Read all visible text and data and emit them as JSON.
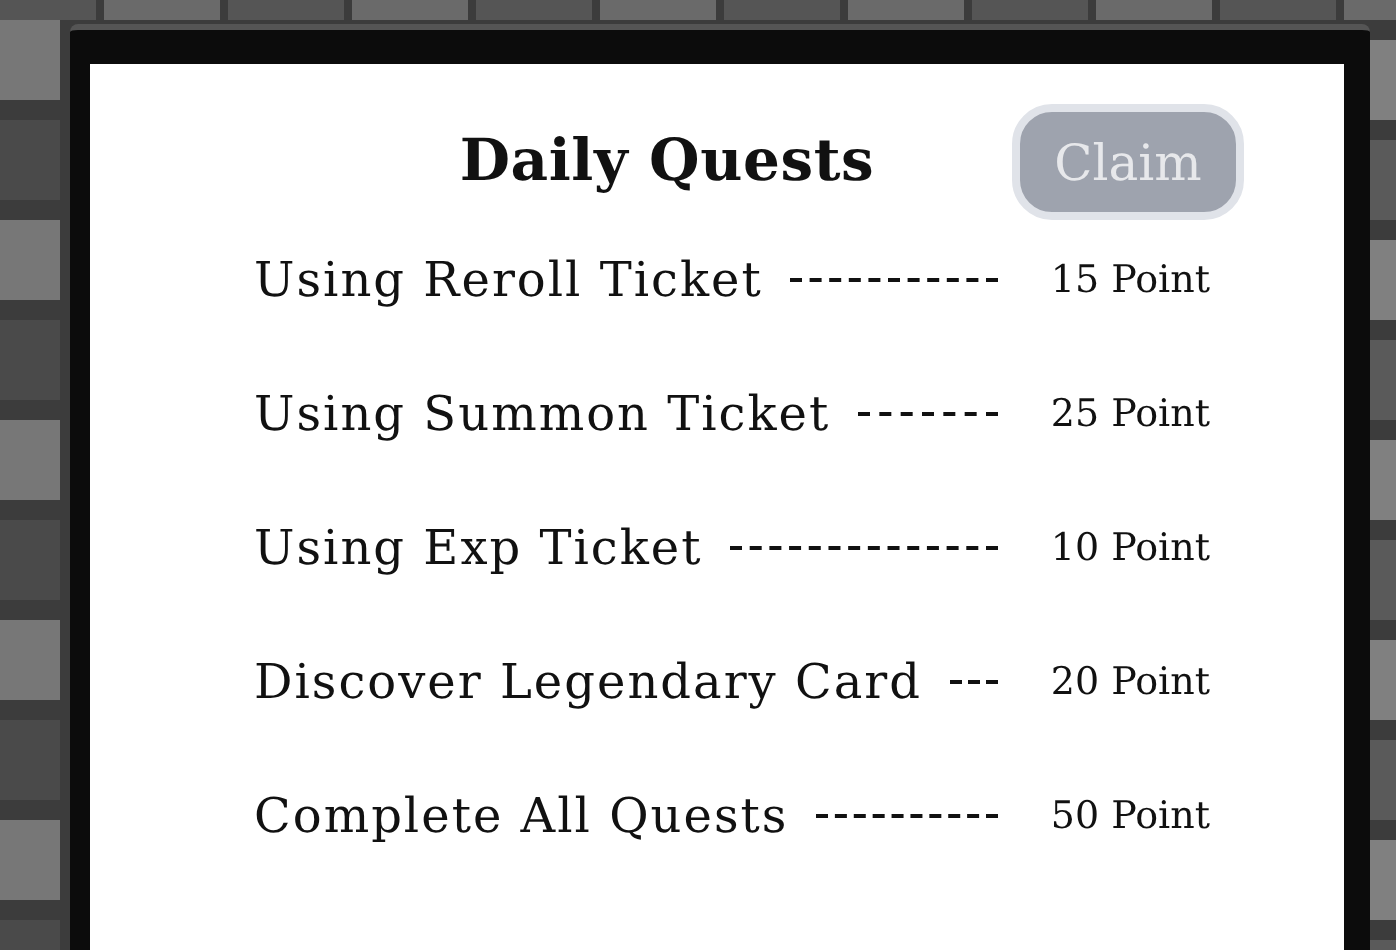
{
  "title": "Daily Quests",
  "claim_button": {
    "label": "Claim",
    "disabled": true
  },
  "quests": [
    {
      "name": "Using Reroll Ticket",
      "reward": "15 Point"
    },
    {
      "name": "Using Summon Ticket",
      "reward": "25 Point"
    },
    {
      "name": "Using Exp Ticket",
      "reward": "10 Point"
    },
    {
      "name": "Discover Legendary Card",
      "reward": "20 Point"
    },
    {
      "name": "Complete All Quests",
      "reward": "50 Point"
    }
  ]
}
